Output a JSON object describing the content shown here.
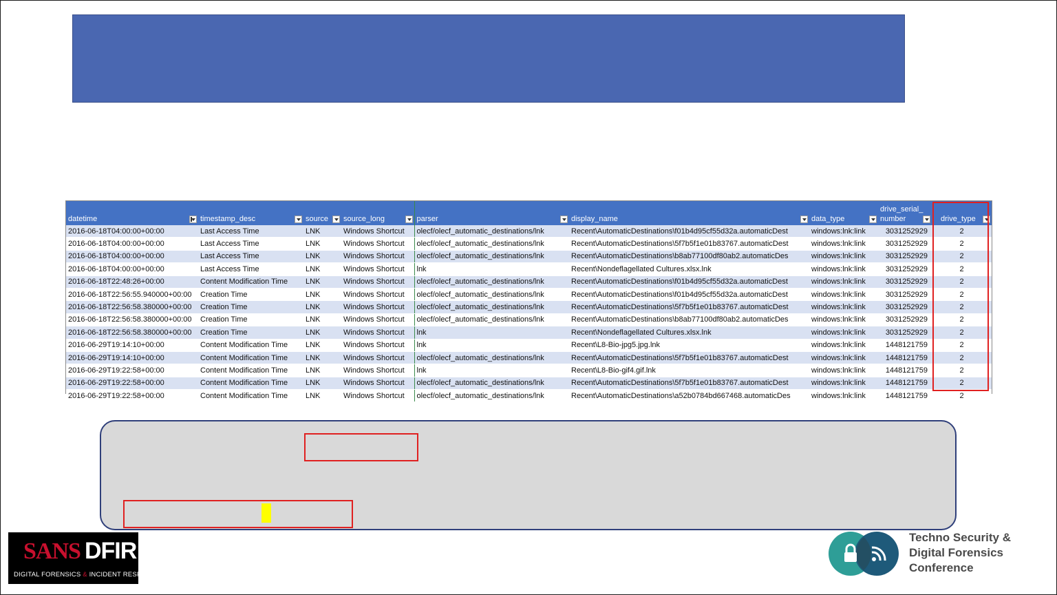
{
  "title": "",
  "sheet": {
    "headers": [
      {
        "label": "datetime",
        "filter": "sorted"
      },
      {
        "label": "timestamp_desc",
        "filter": "dropdown"
      },
      {
        "label": "source",
        "filter": "dropdown"
      },
      {
        "label": "source_long",
        "filter": "dropdown"
      },
      {
        "label": "parser",
        "filter": "dropdown"
      },
      {
        "label": "display_name",
        "filter": "dropdown"
      },
      {
        "label": "data_type",
        "filter": "dropdown"
      },
      {
        "label": "drive_serial_ number",
        "filter": "dropdown"
      },
      {
        "label": "drive_type",
        "filter": "dropdown"
      }
    ],
    "rows": [
      [
        "2016-06-18T04:00:00+00:00",
        "Last Access Time",
        "LNK",
        "Windows Shortcut",
        "olecf/olecf_automatic_destinations/lnk",
        "Recent\\AutomaticDestinations\\f01b4d95cf55d32a.automaticDest",
        "windows:lnk:link",
        "3031252929",
        "2"
      ],
      [
        "2016-06-18T04:00:00+00:00",
        "Last Access Time",
        "LNK",
        "Windows Shortcut",
        "olecf/olecf_automatic_destinations/lnk",
        "Recent\\AutomaticDestinations\\5f7b5f1e01b83767.automaticDest",
        "windows:lnk:link",
        "3031252929",
        "2"
      ],
      [
        "2016-06-18T04:00:00+00:00",
        "Last Access Time",
        "LNK",
        "Windows Shortcut",
        "olecf/olecf_automatic_destinations/lnk",
        "Recent\\AutomaticDestinations\\b8ab77100df80ab2.automaticDes",
        "windows:lnk:link",
        "3031252929",
        "2"
      ],
      [
        "2016-06-18T04:00:00+00:00",
        "Last Access Time",
        "LNK",
        "Windows Shortcut",
        "lnk",
        "Recent\\Nondeflagellated Cultures.xlsx.lnk",
        "windows:lnk:link",
        "3031252929",
        "2"
      ],
      [
        "2016-06-18T22:48:26+00:00",
        "Content Modification Time",
        "LNK",
        "Windows Shortcut",
        "olecf/olecf_automatic_destinations/lnk",
        "Recent\\AutomaticDestinations\\f01b4d95cf55d32a.automaticDest",
        "windows:lnk:link",
        "3031252929",
        "2"
      ],
      [
        "2016-06-18T22:56:55.940000+00:00",
        "Creation Time",
        "LNK",
        "Windows Shortcut",
        "olecf/olecf_automatic_destinations/lnk",
        "Recent\\AutomaticDestinations\\f01b4d95cf55d32a.automaticDest",
        "windows:lnk:link",
        "3031252929",
        "2"
      ],
      [
        "2016-06-18T22:56:58.380000+00:00",
        "Creation Time",
        "LNK",
        "Windows Shortcut",
        "olecf/olecf_automatic_destinations/lnk",
        "Recent\\AutomaticDestinations\\5f7b5f1e01b83767.automaticDest",
        "windows:lnk:link",
        "3031252929",
        "2"
      ],
      [
        "2016-06-18T22:56:58.380000+00:00",
        "Creation Time",
        "LNK",
        "Windows Shortcut",
        "olecf/olecf_automatic_destinations/lnk",
        "Recent\\AutomaticDestinations\\b8ab77100df80ab2.automaticDes",
        "windows:lnk:link",
        "3031252929",
        "2"
      ],
      [
        "2016-06-18T22:56:58.380000+00:00",
        "Creation Time",
        "LNK",
        "Windows Shortcut",
        "lnk",
        "Recent\\Nondeflagellated Cultures.xlsx.lnk",
        "windows:lnk:link",
        "3031252929",
        "2"
      ],
      [
        "2016-06-29T19:14:10+00:00",
        "Content Modification Time",
        "LNK",
        "Windows Shortcut",
        "lnk",
        "Recent\\L8-Bio-jpg5.jpg.lnk",
        "windows:lnk:link",
        "1448121759",
        "2"
      ],
      [
        "2016-06-29T19:14:10+00:00",
        "Content Modification Time",
        "LNK",
        "Windows Shortcut",
        "olecf/olecf_automatic_destinations/lnk",
        "Recent\\AutomaticDestinations\\5f7b5f1e01b83767.automaticDest",
        "windows:lnk:link",
        "1448121759",
        "2"
      ],
      [
        "2016-06-29T19:22:58+00:00",
        "Content Modification Time",
        "LNK",
        "Windows Shortcut",
        "lnk",
        "Recent\\L8-Bio-gif4.gif.lnk",
        "windows:lnk:link",
        "1448121759",
        "2"
      ],
      [
        "2016-06-29T19:22:58+00:00",
        "Content Modification Time",
        "LNK",
        "Windows Shortcut",
        "olecf/olecf_automatic_destinations/lnk",
        "Recent\\AutomaticDestinations\\5f7b5f1e01b83767.automaticDest",
        "windows:lnk:link",
        "1448121759",
        "2"
      ],
      [
        "2016-06-29T19:22:58+00:00",
        "Content Modification Time",
        "LNK",
        "Windows Shortcut",
        "olecf/olecf_automatic_destinations/lnk",
        "Recent\\AutomaticDestinations\\a52b0784bd667468.automaticDes",
        "windows:lnk:link",
        "1448121759",
        "2"
      ]
    ],
    "highlight_column": "drive_type"
  },
  "colors": {
    "title_bar": "#4a67b1",
    "header_fill": "#4472c4",
    "band_fill": "#d9e1f2",
    "highlight_red": "#e02020",
    "note_fill": "#d9d9d9",
    "marker_yellow": "#ffff00"
  },
  "logos": {
    "sans": {
      "word1": "SANS",
      "word2": "DFIR",
      "tagline_a": "DIGITAL FORENSICS ",
      "tagline_amp": "&",
      "tagline_b": " INCIDENT RESPONSE"
    },
    "conference": {
      "line1": "Techno Security &",
      "line2": "Digital Forensics",
      "line3": "Conference",
      "icons": [
        "lock-icon",
        "wifi-signal-icon"
      ]
    }
  }
}
